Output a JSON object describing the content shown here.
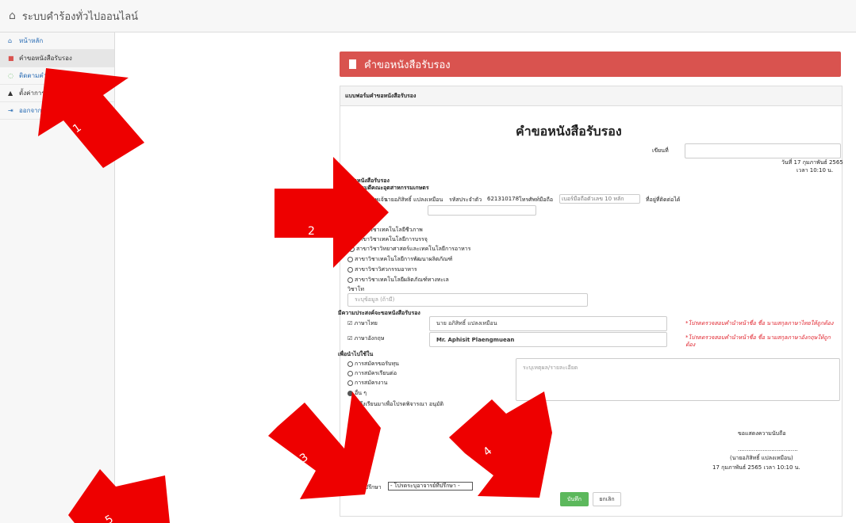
{
  "app": {
    "title": "ระบบคำร้องทั่วไปออนไลน์"
  },
  "sidebar": {
    "items": [
      {
        "label": "หน้าหลัก",
        "icon": "home-icon"
      },
      {
        "label": "คำขอหนังสือรับรอง",
        "icon": "document-icon",
        "active": true
      },
      {
        "label": "ติดตามคำ",
        "icon": "spinner-icon"
      },
      {
        "label": "ตั้งค่าการ",
        "icon": "bell-icon"
      },
      {
        "label": "ออกจาก",
        "icon": "logout-icon"
      }
    ]
  },
  "header": {
    "title": "คำขอหนังสือรับรอง",
    "color": "#d9534f"
  },
  "panel": {
    "heading": "แบบฟอร์มคำขอหนังสือรับรอง"
  },
  "form": {
    "title": "คำขอหนังสือรับรอง",
    "written_at_label": "เขียนที่",
    "date_line": "วันที่ 17 กุมภาพันธ์ 2565",
    "time_line": "เวลา 10:10 น.",
    "subject": "ขอหนังสือรับรอง",
    "to": "คณบดีคณะอุตสาหกรรมเกษตร",
    "intro_prefix": "ข้าพเจ้า",
    "name": "นายอภิสิทธิ์ แปลงเหมือน",
    "student_id_label": "รหัสประจำตัว",
    "student_id": "621310178",
    "phone_label": "โทรศัพท์มือถือ",
    "phone_placeholder": "เบอร์มือถือตัวเลข 10 หลัก",
    "reachable": "ที่อยู่ที่ติดต่อได้",
    "majors": [
      "สาขาวิชาเทคโนโลยีชีวภาพ",
      "สาขาวิชาเทคโนโลยีการบรรจุ",
      "สาขาวิชาวิทยาศาสตร์และเทคโนโลยีการอาหาร",
      "สาขาวิชาเทคโนโลยีการพัฒนาผลิตภัณฑ์",
      "สาขาวิชาวิศวกรรมอาหาร",
      "สาขาวิชาเทคโนโลยีผลิตภัณฑ์ทางทะเล"
    ],
    "minor_label": "วิชาโท",
    "minor_placeholder": "ระบุข้อมูล (ถ้ามี)",
    "purpose_heading": "มีความประสงค์จะขอหนังสือรับรอง",
    "lang_thai_label": "ภาษาไทย",
    "lang_thai_value": "นาย อภิสิทธิ์  แปลงเหมือน",
    "lang_eng_label": "ภาษาอังกฤษ",
    "lang_eng_value": "Mr. Aphisit  Plaengmuean",
    "note_thai": "*โปรดตรวจสอบคำนำหน้าชื่อ ชื่อ นามสกุลภาษาไทยให้ถูกต้อง",
    "note_eng_1": "*โปรดตรวจสอบคำนำหน้าชื่อ ชื่อ นามสกุลภาษาอังกฤษให้ถูก",
    "note_eng_2": "ต้อง",
    "use_heading": "เพื่อนำไปใช้ใน",
    "uses": [
      "การสมัครขอรับทุน",
      "การสมัครเรียนต่อ",
      "การสมัครงาน",
      "อื่น ๆ"
    ],
    "reason_placeholder": "ระบุเหตุผล/รายละเอียด",
    "closing": "จึงเรียนมาเพื่อโปรดพิจารณา อนุมัติ",
    "respect": "ขอแสดงความนับถือ",
    "sign_line": "..................................",
    "sign_name": "(นายอภิสิทธิ์ แปลงเหมือน)",
    "sign_date": "17 กุมภาพันธ์ 2565 เวลา 10:10 น.",
    "advisor_label": "อาจารย์ที่ปรึกษา",
    "advisor_select": "- โปรดระบุอาจารย์ที่ปรึกษา -",
    "save_label": "บันทึก",
    "cancel_label": "ยกเลิก"
  },
  "annotations": {
    "labels": [
      "1",
      "2",
      "3",
      "4",
      "5"
    ],
    "arrow_color": "#ee0000"
  }
}
